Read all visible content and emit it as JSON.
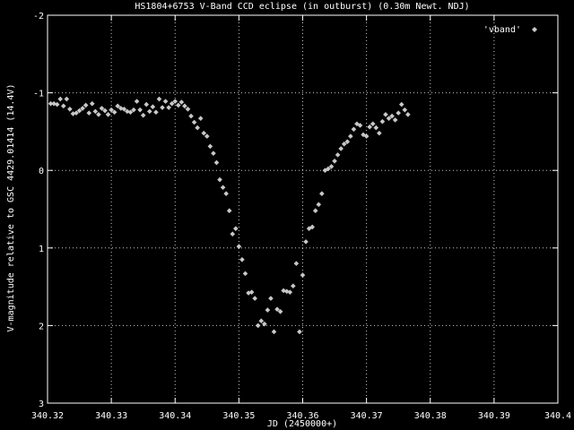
{
  "chart_data": {
    "type": "scatter",
    "title": "HS1804+6753 V-Band CCD eclipse (in outburst) (0.30m Newt. NDJ)",
    "xlabel": "JD (2450000+)",
    "ylabel": "V-magnitude relative to GSC 4429.01414 (14.4V)",
    "xlim": [
      340.32,
      340.4
    ],
    "ylim": [
      3,
      -2
    ],
    "y_inverted": true,
    "grid": true,
    "legend_position": "top-right",
    "xticks": [
      {
        "v": 340.32,
        "label": "340.32"
      },
      {
        "v": 340.33,
        "label": "340.33"
      },
      {
        "v": 340.34,
        "label": "340.34"
      },
      {
        "v": 340.35,
        "label": "340.35"
      },
      {
        "v": 340.36,
        "label": "340.36"
      },
      {
        "v": 340.37,
        "label": "340.37"
      },
      {
        "v": 340.38,
        "label": "340.38"
      },
      {
        "v": 340.39,
        "label": "340.39"
      },
      {
        "v": 340.4,
        "label": "340.4"
      }
    ],
    "yticks": [
      {
        "v": -2,
        "label": "-2"
      },
      {
        "v": -1,
        "label": "-1"
      },
      {
        "v": 0,
        "label": "0"
      },
      {
        "v": 1,
        "label": "1"
      },
      {
        "v": 2,
        "label": "2"
      },
      {
        "v": 3,
        "label": "3"
      }
    ],
    "colors": {
      "background": "#000000",
      "axes": "#ffffff",
      "grid": "#c8c8c8",
      "points": "#c8c8c8",
      "text": "#ffffff"
    },
    "series": [
      {
        "name": "'vband'",
        "marker": "diamond",
        "points": [
          [
            340.3205,
            -0.86
          ],
          [
            340.321,
            -0.86
          ],
          [
            340.3215,
            -0.85
          ],
          [
            340.322,
            -0.92
          ],
          [
            340.3225,
            -0.83
          ],
          [
            340.323,
            -0.92
          ],
          [
            340.3235,
            -0.79
          ],
          [
            340.324,
            -0.73
          ],
          [
            340.3245,
            -0.74
          ],
          [
            340.325,
            -0.77
          ],
          [
            340.3255,
            -0.8
          ],
          [
            340.326,
            -0.84
          ],
          [
            340.3265,
            -0.74
          ],
          [
            340.327,
            -0.86
          ],
          [
            340.3275,
            -0.76
          ],
          [
            340.328,
            -0.72
          ],
          [
            340.3285,
            -0.8
          ],
          [
            340.329,
            -0.77
          ],
          [
            340.3295,
            -0.72
          ],
          [
            340.33,
            -0.78
          ],
          [
            340.3305,
            -0.75
          ],
          [
            340.331,
            -0.83
          ],
          [
            340.3315,
            -0.8
          ],
          [
            340.332,
            -0.79
          ],
          [
            340.3325,
            -0.76
          ],
          [
            340.333,
            -0.75
          ],
          [
            340.3335,
            -0.78
          ],
          [
            340.334,
            -0.89
          ],
          [
            340.3345,
            -0.78
          ],
          [
            340.335,
            -0.71
          ],
          [
            340.3355,
            -0.85
          ],
          [
            340.336,
            -0.76
          ],
          [
            340.3365,
            -0.82
          ],
          [
            340.337,
            -0.75
          ],
          [
            340.3375,
            -0.92
          ],
          [
            340.338,
            -0.81
          ],
          [
            340.3385,
            -0.89
          ],
          [
            340.339,
            -0.81
          ],
          [
            340.3395,
            -0.86
          ],
          [
            340.34,
            -0.89
          ],
          [
            340.3405,
            -0.84
          ],
          [
            340.341,
            -0.88
          ],
          [
            340.3415,
            -0.83
          ],
          [
            340.342,
            -0.79
          ],
          [
            340.3425,
            -0.7
          ],
          [
            340.343,
            -0.62
          ],
          [
            340.3435,
            -0.55
          ],
          [
            340.344,
            -0.67
          ],
          [
            340.3445,
            -0.48
          ],
          [
            340.345,
            -0.44
          ],
          [
            340.3455,
            -0.31
          ],
          [
            340.346,
            -0.22
          ],
          [
            340.3465,
            -0.1
          ],
          [
            340.347,
            0.12
          ],
          [
            340.3475,
            0.22
          ],
          [
            340.348,
            0.3
          ],
          [
            340.3485,
            0.52
          ],
          [
            340.349,
            0.82
          ],
          [
            340.3495,
            0.75
          ],
          [
            340.35,
            0.98
          ],
          [
            340.3505,
            1.15
          ],
          [
            340.351,
            1.33
          ],
          [
            340.3515,
            1.58
          ],
          [
            340.352,
            1.57
          ],
          [
            340.3525,
            1.65
          ],
          [
            340.353,
            2.0
          ],
          [
            340.3535,
            1.94
          ],
          [
            340.354,
            1.98
          ],
          [
            340.3545,
            1.8
          ],
          [
            340.355,
            1.65
          ],
          [
            340.3555,
            2.08
          ],
          [
            340.356,
            1.79
          ],
          [
            340.3565,
            1.82
          ],
          [
            340.357,
            1.55
          ],
          [
            340.3575,
            1.56
          ],
          [
            340.358,
            1.57
          ],
          [
            340.3585,
            1.49
          ],
          [
            340.359,
            1.2
          ],
          [
            340.3595,
            2.08
          ],
          [
            340.36,
            1.35
          ],
          [
            340.3605,
            0.92
          ],
          [
            340.361,
            0.75
          ],
          [
            340.3615,
            0.73
          ],
          [
            340.362,
            0.52
          ],
          [
            340.3625,
            0.44
          ],
          [
            340.363,
            0.3
          ],
          [
            340.3635,
            0.0
          ],
          [
            340.364,
            -0.02
          ],
          [
            340.3645,
            -0.05
          ],
          [
            340.365,
            -0.12
          ],
          [
            340.3655,
            -0.2
          ],
          [
            340.366,
            -0.28
          ],
          [
            340.3665,
            -0.34
          ],
          [
            340.367,
            -0.37
          ],
          [
            340.3675,
            -0.44
          ],
          [
            340.368,
            -0.53
          ],
          [
            340.3685,
            -0.6
          ],
          [
            340.369,
            -0.58
          ],
          [
            340.3695,
            -0.46
          ],
          [
            340.37,
            -0.44
          ],
          [
            340.3705,
            -0.56
          ],
          [
            340.371,
            -0.6
          ],
          [
            340.3715,
            -0.55
          ],
          [
            340.372,
            -0.48
          ],
          [
            340.3725,
            -0.63
          ],
          [
            340.373,
            -0.72
          ],
          [
            340.3735,
            -0.67
          ],
          [
            340.374,
            -0.7
          ],
          [
            340.3745,
            -0.65
          ],
          [
            340.375,
            -0.74
          ],
          [
            340.3755,
            -0.85
          ],
          [
            340.376,
            -0.78
          ],
          [
            340.3765,
            -0.72
          ]
        ]
      }
    ]
  }
}
